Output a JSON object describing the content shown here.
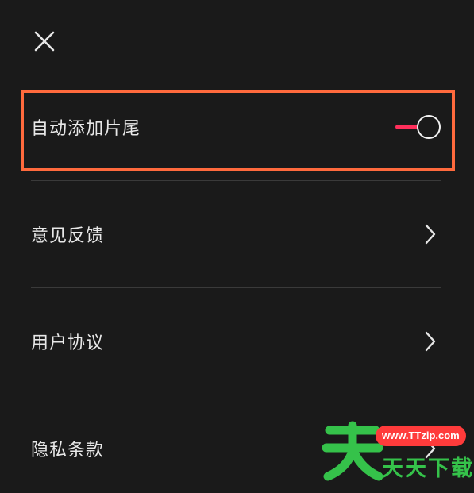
{
  "header": {
    "close_icon": "close-icon"
  },
  "settings": {
    "items": [
      {
        "label": "自动添加片尾",
        "control": "toggle",
        "toggle_on": true
      },
      {
        "label": "意见反馈",
        "control": "chevron-right-icon"
      },
      {
        "label": "用户协议",
        "control": "chevron-right-icon"
      },
      {
        "label": "隐私条款",
        "control": "chevron-right-icon"
      }
    ]
  },
  "watermark": {
    "url": "www.TTzip.com",
    "text": "天天下载"
  },
  "colors": {
    "background": "#1a1a1a",
    "text": "#e8e8e8",
    "divider": "#3a3a3a",
    "highlight": "#ff6a3d",
    "toggle_track": "#ff2f5b",
    "watermark_green": "#35c24a",
    "watermark_red": "#ff3b3b"
  }
}
